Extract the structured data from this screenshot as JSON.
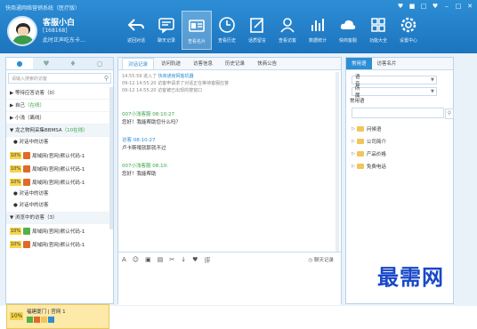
{
  "app": {
    "title": "快商通网络营销系统（医疗版）"
  },
  "window_controls": [
    "♥",
    "■",
    "□",
    "♥",
    "‒",
    "□",
    "✕"
  ],
  "profile": {
    "name": "客服小白",
    "id": "[168168]",
    "motto": "此时正声吃东卡…"
  },
  "toolbar": [
    {
      "label": "返回对话",
      "icon": "back-arrow-icon"
    },
    {
      "label": "聊天记录",
      "icon": "chat-record-icon"
    },
    {
      "label": "查看名片",
      "icon": "card-icon",
      "active": true
    },
    {
      "label": "查看历史",
      "icon": "clock-icon"
    },
    {
      "label": "话质留言",
      "icon": "note-icon"
    },
    {
      "label": "查看访客",
      "icon": "visitor-icon"
    },
    {
      "label": "数据统计",
      "icon": "chart-icon"
    },
    {
      "label": "快商客服",
      "icon": "cloud-icon"
    },
    {
      "label": "功能大全",
      "icon": "grid-icon"
    },
    {
      "label": "设置中心",
      "icon": "gear-icon"
    }
  ],
  "left": {
    "tabs": [
      "●",
      "♥",
      "♦",
      "○"
    ],
    "search_placeholder": "请输入搜索的访客",
    "groups": [
      {
        "label": "▶ 等待应答访客（0）"
      },
      {
        "label": "▶ 自己",
        "tag": "（在线）"
      },
      {
        "label": "▶ 小浅（离线）"
      },
      {
        "label": "▼ 龙之物网采集BBMSA",
        "tag": "（10在线）"
      }
    ],
    "sub1": "● 对话中的访客",
    "visitors": [
      {
        "pct": "10%",
        "name": "局域网(官网)默认代码-1"
      },
      {
        "pct": "10%",
        "name": "局域网(官网)默认代码-1"
      },
      {
        "pct": "10%",
        "name": "局域网(官网)默认代码-1"
      }
    ],
    "sub2": "● 对话中的访客",
    "sub3": "● 对话中的访客",
    "group_chat": "▼ 浏览中的访客（3）",
    "visitors2": [
      {
        "pct": "10%",
        "name": "局域网(官网)默认代码-1"
      },
      {
        "pct": "10%",
        "name": "局域网(官网)默认代码-1"
      }
    ],
    "selected": {
      "pct": "10%",
      "name": "福建厦门 | 官网 1"
    }
  },
  "center": {
    "tabs": [
      "对话记录",
      "访问轨迹",
      "访客信息",
      "历史记录",
      "快商公告"
    ],
    "log": [
      {
        "time": "14:55:59",
        "text": "进入了",
        "link": "快商通官网客机器"
      },
      {
        "time": "09-12 14:55:20",
        "text": "访客申请求了对话正在等待客服应答"
      },
      {
        "time": "09-12 14:55:20",
        "text": "访客被已出现的按窗口"
      }
    ],
    "messages": [
      {
        "who": "007小浅客服 08:10:27",
        "text": "您好！我能帮助您什么吗？"
      },
      {
        "who": "访客 08:10:27",
        "text": "卢卡斯哦就那就不过"
      },
      {
        "who": "007小浅客服 08:10:",
        "text": "您好！我能帮助"
      }
    ],
    "composer_tools": [
      "A",
      "☺",
      "▣",
      "▤",
      "✂",
      "↓",
      "♥",
      "评"
    ],
    "history_label": "◷ 聊天记录"
  },
  "right": {
    "tabs": [
      "常用语",
      "访客名片"
    ],
    "field1": "语  音",
    "field2": "所  属",
    "usual_label": "常用语",
    "folders": [
      "问候语",
      "公司简介",
      "产品价格",
      "免费电话"
    ]
  },
  "watermark": "最需网"
}
